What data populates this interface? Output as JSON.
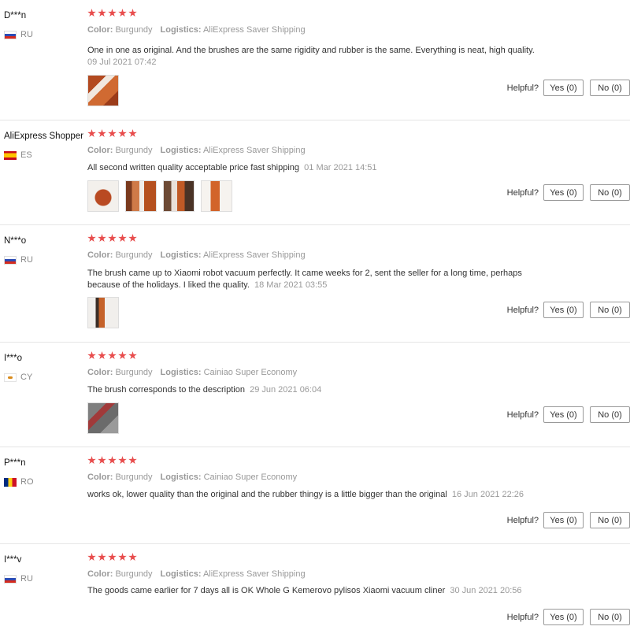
{
  "colors": {
    "star": "#e84d4d",
    "meta_text": "#999999",
    "divider": "#e6e6e6"
  },
  "helpful_label": "Helpful?",
  "reviews": [
    {
      "user": "D***n",
      "country": "RU",
      "rating": 5,
      "color_label": "Color:",
      "color_value": "Burgundy",
      "logistics_label": "Logistics:",
      "logistics_value": "AliExpress Saver Shipping",
      "text": "One in one as original. And the brushes are the same rigidity and rubber is the same. Everything is neat, high quality.",
      "date": "09 Jul 2021 07:42",
      "yes": "Yes (0)",
      "no": "No (0)"
    },
    {
      "user": "AliExpress Shopper",
      "country": "ES",
      "rating": 5,
      "color_label": "Color:",
      "color_value": "Burgundy",
      "logistics_label": "Logistics:",
      "logistics_value": "AliExpress Saver Shipping",
      "text": "All second written quality acceptable price fast shipping",
      "date": "01 Mar 2021 14:51",
      "yes": "Yes (0)",
      "no": "No (0)"
    },
    {
      "user": "N***o",
      "country": "RU",
      "rating": 5,
      "color_label": "Color:",
      "color_value": "Burgundy",
      "logistics_label": "Logistics:",
      "logistics_value": "AliExpress Saver Shipping",
      "text": "The brush came up to Xiaomi robot vacuum perfectly. It came weeks for 2, sent the seller for a long time, perhaps because of the holidays. I liked the quality.",
      "date": "18 Mar 2021 03:55",
      "yes": "Yes (0)",
      "no": "No (0)"
    },
    {
      "user": "I***o",
      "country": "CY",
      "rating": 5,
      "color_label": "Color:",
      "color_value": "Burgundy",
      "logistics_label": "Logistics:",
      "logistics_value": "Cainiao Super Economy",
      "text": "The brush corresponds to the description",
      "date": "29 Jun 2021 06:04",
      "yes": "Yes (0)",
      "no": "No (0)"
    },
    {
      "user": "P***n",
      "country": "RO",
      "rating": 5,
      "color_label": "Color:",
      "color_value": "Burgundy",
      "logistics_label": "Logistics:",
      "logistics_value": "Cainiao Super Economy",
      "text": "works ok, lower quality than the original and the rubber thingy is a little bigger than the original",
      "date": "16 Jun 2021 22:26",
      "yes": "Yes (0)",
      "no": "No (0)"
    },
    {
      "user": "I***v",
      "country": "RU",
      "rating": 5,
      "color_label": "Color:",
      "color_value": "Burgundy",
      "logistics_label": "Logistics:",
      "logistics_value": "AliExpress Saver Shipping",
      "text": "The goods came earlier for 7 days all is OK Whole G Kemerovo pylisos Xiaomi vacuum cliner",
      "date": "30 Jun 2021 20:56",
      "yes": "Yes (0)",
      "no": "No (0)"
    }
  ]
}
